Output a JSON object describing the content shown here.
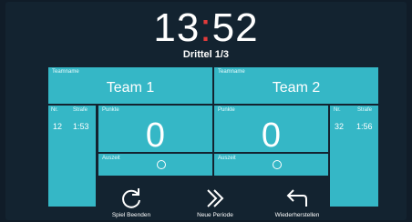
{
  "clock": {
    "minutes": "13",
    "separator": ":",
    "seconds": "52"
  },
  "period": "Drittel 1/3",
  "team1": {
    "name_label": "Teamname",
    "name": "Team 1",
    "points_label": "Punkte",
    "points": "0",
    "timeout_label": "Auszeit",
    "penalty": {
      "nr_label": "Nr.",
      "strafe_label": "Strafe",
      "nr": "12",
      "time": "1:53"
    }
  },
  "team2": {
    "name_label": "Teamname",
    "name": "Team 2",
    "points_label": "Punkte",
    "points": "0",
    "timeout_label": "Auszeit",
    "penalty": {
      "nr_label": "Nr.",
      "strafe_label": "Strafe",
      "nr": "32",
      "time": "1:56"
    }
  },
  "actions": {
    "end_game": "Spiel Beenden",
    "next_period": "Neue Periode",
    "restore": "Wiederherstellen"
  },
  "colors": {
    "panel": "#35b7c6",
    "background": "#132330",
    "colon": "#e23b3b"
  }
}
